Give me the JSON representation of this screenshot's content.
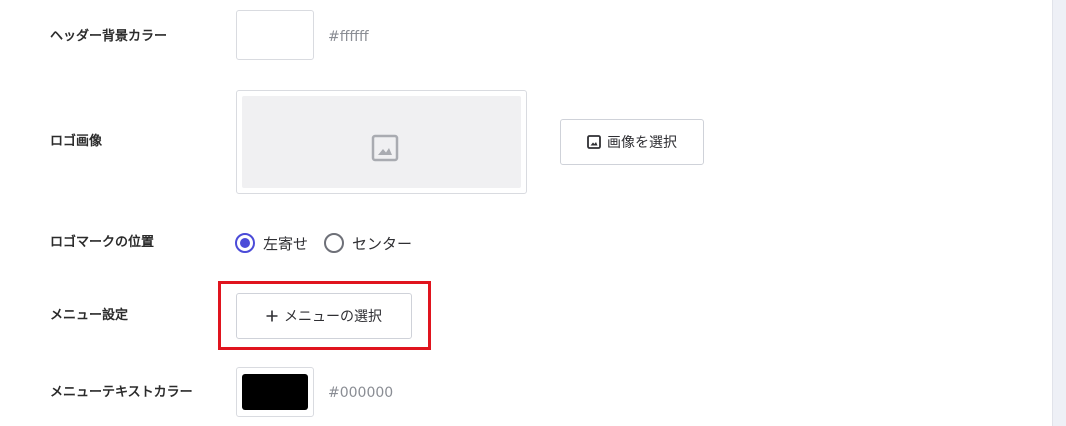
{
  "header_bg": {
    "label": "ヘッダー背景カラー",
    "value": "#ffffff",
    "color": "#ffffff"
  },
  "logo": {
    "label": "ロゴ画像",
    "placeholder_icon": "image-placeholder-icon",
    "select_button": {
      "icon": "image-icon",
      "label": "画像を選択"
    }
  },
  "logo_position": {
    "label": "ロゴマークの位置",
    "options": [
      {
        "label": "左寄せ",
        "checked": true
      },
      {
        "label": "センター",
        "checked": false
      }
    ],
    "accent_color": "#4b4bd8"
  },
  "menu_settings": {
    "label": "メニュー設定",
    "button": {
      "icon": "plus-icon",
      "label": "メニューの選択"
    },
    "highlight_color": "#e0141e"
  },
  "menu_text_color": {
    "label": "メニューテキストカラー",
    "value": "#000000",
    "color": "#000000"
  }
}
